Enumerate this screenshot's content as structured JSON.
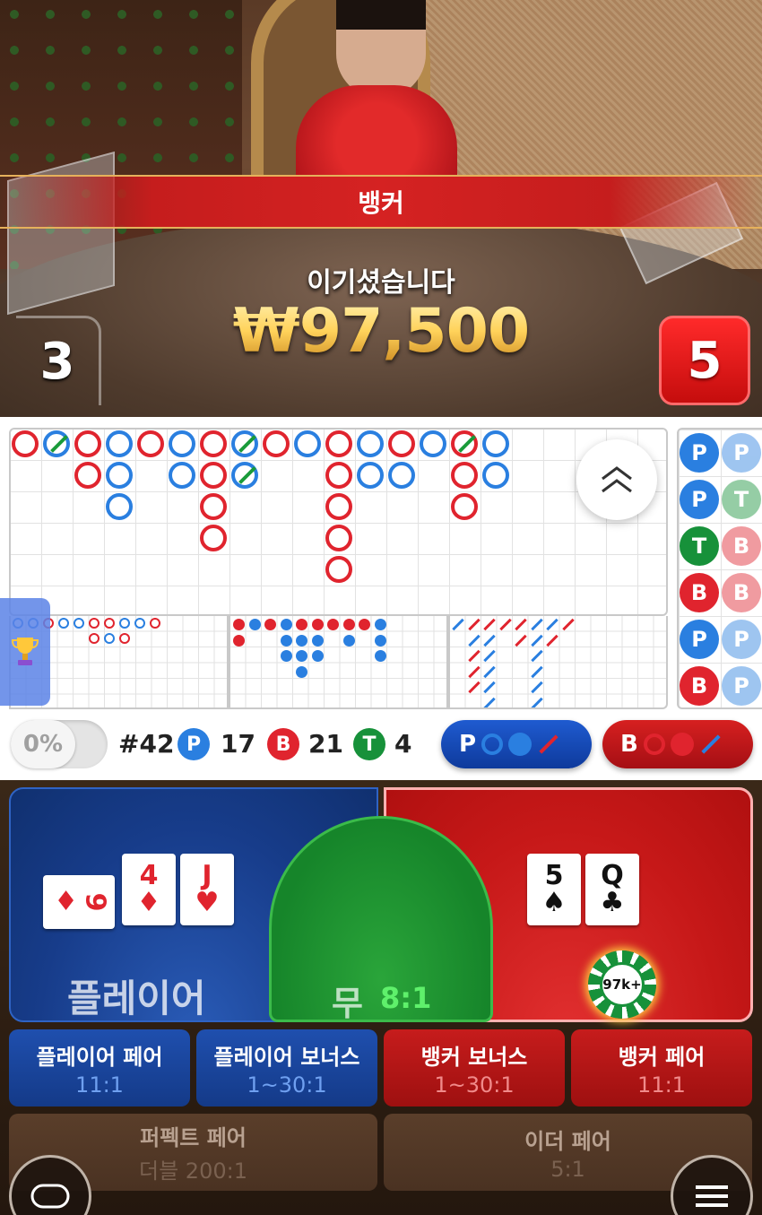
{
  "result": {
    "banner": "뱅커",
    "win_text": "이기셨습니다",
    "win_amount": "₩97,500",
    "player_score": "3",
    "banker_score": "5"
  },
  "stats": {
    "percent": "0%",
    "round": "#42",
    "player_letter": "P",
    "player_count": "17",
    "banker_letter": "B",
    "banker_count": "21",
    "tie_letter": "T",
    "tie_count": "4",
    "ask_player": "P",
    "ask_banker": "B"
  },
  "beads": [
    [
      "P",
      "P"
    ],
    [
      "P",
      "T"
    ],
    [
      "T",
      "B"
    ],
    [
      "B",
      "B"
    ],
    [
      "P",
      "P"
    ],
    [
      "B",
      "P"
    ]
  ],
  "bets": {
    "player_label": "플레이어",
    "tie_label": "무",
    "tie_odds": "8:1",
    "chip_label": "97k+",
    "player_cards": [
      {
        "rank": "9",
        "suit": "♦",
        "color": "red",
        "side": true
      },
      {
        "rank": "4",
        "suit": "♦",
        "color": "red",
        "side": false
      },
      {
        "rank": "J",
        "suit": "♥",
        "color": "red",
        "side": false
      }
    ],
    "banker_cards": [
      {
        "rank": "5",
        "suit": "♠",
        "color": "black"
      },
      {
        "rank": "Q",
        "suit": "♣",
        "color": "black"
      }
    ],
    "side_bets": [
      {
        "title": "플레이어 페어",
        "odds": "11:1"
      },
      {
        "title": "플레이어 보너스",
        "odds": "1~30:1"
      },
      {
        "title": "뱅커 보너스",
        "odds": "1~30:1"
      },
      {
        "title": "뱅커 페어",
        "odds": "11:1"
      },
      {
        "title": "퍼펙트 페어",
        "odds": "더블 200:1"
      },
      {
        "title": "이더 페어",
        "odds": "5:1"
      }
    ]
  },
  "colors": {
    "player": "#2a7fe0",
    "banker": "#e0242e",
    "tie": "#17913a",
    "win_gold": "#ffd25a"
  },
  "icons": {
    "collapse": "chevron-double-up-icon",
    "trophy": "trophy-icon",
    "chat": "chat-bubble-icon",
    "menu": "hamburger-menu-icon"
  }
}
